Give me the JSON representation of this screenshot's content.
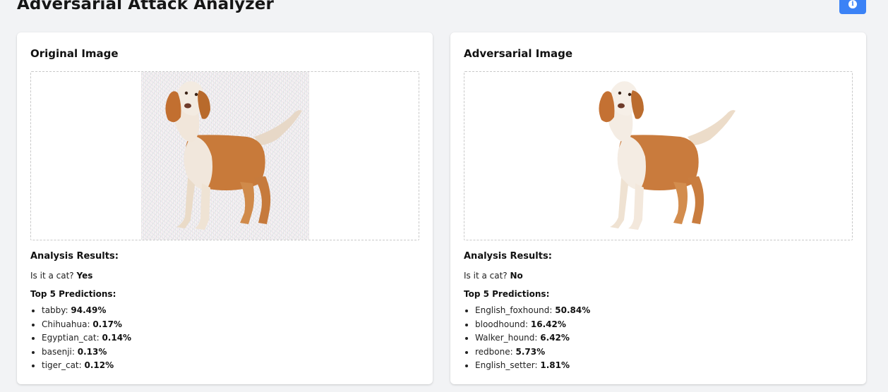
{
  "header": {
    "title": "Adversarial Attack Analyzer",
    "info_icon": "info-icon"
  },
  "colors": {
    "accent": "#3b82f6",
    "background": "#f2f3f5",
    "card": "#ffffff"
  },
  "original": {
    "title": "Original Image",
    "analysis_heading": "Analysis Results:",
    "cat_question": "Is it a cat?",
    "cat_answer": "Yes",
    "predictions_heading": "Top 5 Predictions:",
    "predictions": [
      {
        "label": "tabby:",
        "value": "94.49%"
      },
      {
        "label": "Chihuahua:",
        "value": "0.17%"
      },
      {
        "label": "Egyptian_cat:",
        "value": "0.14%"
      },
      {
        "label": "basenji:",
        "value": "0.13%"
      },
      {
        "label": "tiger_cat:",
        "value": "0.12%"
      }
    ]
  },
  "adversarial": {
    "title": "Adversarial Image",
    "analysis_heading": "Analysis Results:",
    "cat_question": "Is it a cat?",
    "cat_answer": "No",
    "predictions_heading": "Top 5 Predictions:",
    "predictions": [
      {
        "label": "English_foxhound:",
        "value": "50.84%"
      },
      {
        "label": "bloodhound:",
        "value": "16.42%"
      },
      {
        "label": "Walker_hound:",
        "value": "6.42%"
      },
      {
        "label": "redbone:",
        "value": "5.73%"
      },
      {
        "label": "English_setter:",
        "value": "1.81%"
      }
    ]
  }
}
